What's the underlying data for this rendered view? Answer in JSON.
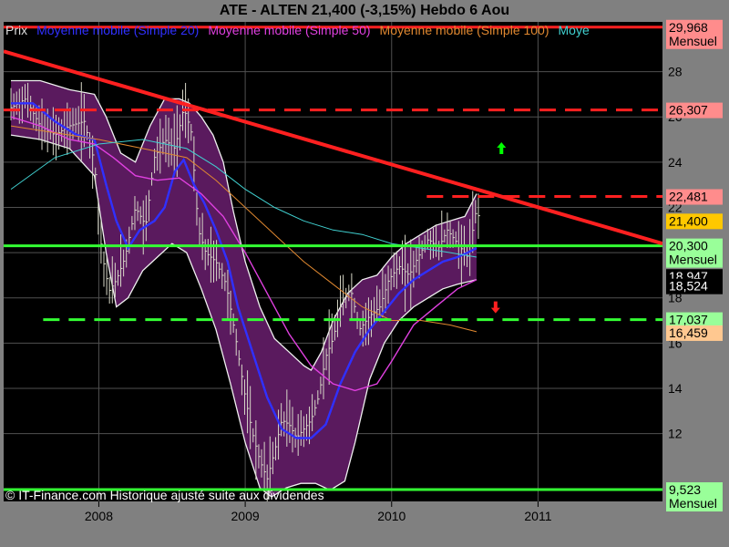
{
  "chart_data": {
    "type": "line",
    "title": "ATE - ALTEN    21,400 (-3,15%)    Hebdo  6 Aou",
    "footer": "© IT-Finance.com Historique ajusté suite aux dividendes",
    "legend": [
      {
        "label": "Prix",
        "color": "#dddddd"
      },
      {
        "label": "Moyenne mobile (Simple 20)",
        "color": "#3030ff"
      },
      {
        "label": "Moyenne mobile (Simple 50)",
        "color": "#e040e0"
      },
      {
        "label": "Moyenne mobile (Simple 100)",
        "color": "#e08830"
      },
      {
        "label": "Moye",
        "color": "#40d0d0"
      }
    ],
    "legend_placement": "top-left",
    "x_ticks": [
      2008,
      2009,
      2010,
      2011
    ],
    "xlim": [
      2007.35,
      2011.85
    ],
    "y_ticks": [
      12,
      14,
      16,
      18,
      20,
      22,
      24,
      26,
      28
    ],
    "ylim": [
      9.0,
      30.2
    ],
    "grid": true,
    "price": [
      [
        2007.4,
        26.4
      ],
      [
        2007.5,
        26.8
      ],
      [
        2007.6,
        25.6
      ],
      [
        2007.7,
        25.2
      ],
      [
        2007.8,
        25.6
      ],
      [
        2007.9,
        25.8
      ],
      [
        2007.97,
        24.0
      ],
      [
        2008.02,
        20.0
      ],
      [
        2008.07,
        18.3
      ],
      [
        2008.12,
        18.8
      ],
      [
        2008.18,
        19.8
      ],
      [
        2008.25,
        22.0
      ],
      [
        2008.32,
        21.2
      ],
      [
        2008.38,
        24.2
      ],
      [
        2008.45,
        25.0
      ],
      [
        2008.52,
        24.6
      ],
      [
        2008.58,
        26.4
      ],
      [
        2008.63,
        25.4
      ],
      [
        2008.68,
        21.0
      ],
      [
        2008.73,
        20.0
      ],
      [
        2008.8,
        19.6
      ],
      [
        2008.87,
        18.6
      ],
      [
        2008.93,
        16.4
      ],
      [
        2009.0,
        13.6
      ],
      [
        2009.05,
        12.0
      ],
      [
        2009.1,
        10.8
      ],
      [
        2009.15,
        10.0
      ],
      [
        2009.2,
        11.2
      ],
      [
        2009.25,
        12.6
      ],
      [
        2009.3,
        12.4
      ],
      [
        2009.35,
        11.8
      ],
      [
        2009.4,
        12.2
      ],
      [
        2009.45,
        12.6
      ],
      [
        2009.5,
        13.6
      ],
      [
        2009.55,
        15.4
      ],
      [
        2009.6,
        16.2
      ],
      [
        2009.65,
        17.6
      ],
      [
        2009.72,
        18.4
      ],
      [
        2009.78,
        16.6
      ],
      [
        2009.85,
        17.2
      ],
      [
        2009.92,
        17.6
      ],
      [
        2009.98,
        18.8
      ],
      [
        2010.05,
        19.4
      ],
      [
        2010.12,
        19.0
      ],
      [
        2010.18,
        19.8
      ],
      [
        2010.25,
        20.6
      ],
      [
        2010.32,
        20.2
      ],
      [
        2010.38,
        21.0
      ],
      [
        2010.45,
        20.4
      ],
      [
        2010.52,
        19.8
      ],
      [
        2010.56,
        21.2
      ],
      [
        2010.58,
        22.0
      ],
      [
        2010.6,
        21.4
      ]
    ],
    "series": [
      {
        "name": "Moyenne mobile (Simple 20)",
        "color": "#3030ff",
        "points": [
          [
            2007.4,
            26.6
          ],
          [
            2007.55,
            26.6
          ],
          [
            2007.7,
            25.8
          ],
          [
            2007.85,
            25.2
          ],
          [
            2007.97,
            25.0
          ],
          [
            2008.05,
            23.0
          ],
          [
            2008.12,
            21.4
          ],
          [
            2008.2,
            20.2
          ],
          [
            2008.28,
            21.0
          ],
          [
            2008.38,
            21.4
          ],
          [
            2008.45,
            22.0
          ],
          [
            2008.52,
            23.6
          ],
          [
            2008.58,
            24.1
          ],
          [
            2008.65,
            23.0
          ],
          [
            2008.72,
            22.2
          ],
          [
            2008.8,
            21.0
          ],
          [
            2008.88,
            19.6
          ],
          [
            2008.95,
            17.6
          ],
          [
            2009.05,
            15.6
          ],
          [
            2009.15,
            13.6
          ],
          [
            2009.25,
            12.2
          ],
          [
            2009.35,
            11.8
          ],
          [
            2009.45,
            11.8
          ],
          [
            2009.55,
            12.4
          ],
          [
            2009.65,
            14.2
          ],
          [
            2009.75,
            15.6
          ],
          [
            2009.85,
            16.6
          ],
          [
            2009.95,
            17.4
          ],
          [
            2010.05,
            18.2
          ],
          [
            2010.15,
            18.8
          ],
          [
            2010.25,
            19.2
          ],
          [
            2010.35,
            19.6
          ],
          [
            2010.45,
            19.8
          ],
          [
            2010.52,
            20.0
          ],
          [
            2010.58,
            20.2
          ]
        ]
      },
      {
        "name": "Moyenne mobile (Simple 50)",
        "color": "#e040e0",
        "points": [
          [
            2007.4,
            26.0
          ],
          [
            2007.6,
            25.6
          ],
          [
            2007.8,
            25.0
          ],
          [
            2007.97,
            24.8
          ],
          [
            2008.1,
            24.2
          ],
          [
            2008.25,
            23.4
          ],
          [
            2008.4,
            23.2
          ],
          [
            2008.55,
            23.3
          ],
          [
            2008.7,
            22.6
          ],
          [
            2008.85,
            21.6
          ],
          [
            2009.0,
            20.0
          ],
          [
            2009.15,
            18.2
          ],
          [
            2009.3,
            16.4
          ],
          [
            2009.45,
            15.0
          ],
          [
            2009.6,
            14.2
          ],
          [
            2009.75,
            13.9
          ],
          [
            2009.9,
            14.2
          ],
          [
            2010.0,
            15.2
          ],
          [
            2010.15,
            16.8
          ],
          [
            2010.3,
            17.6
          ],
          [
            2010.45,
            18.4
          ],
          [
            2010.58,
            18.8
          ]
        ]
      },
      {
        "name": "Moyenne mobile (Simple 100)",
        "color": "#e08830",
        "points": [
          [
            2007.4,
            25.6
          ],
          [
            2007.7,
            25.3
          ],
          [
            2008.0,
            25.0
          ],
          [
            2008.3,
            24.6
          ],
          [
            2008.6,
            24.2
          ],
          [
            2008.8,
            23.2
          ],
          [
            2009.0,
            22.0
          ],
          [
            2009.2,
            20.8
          ],
          [
            2009.4,
            19.6
          ],
          [
            2009.6,
            18.6
          ],
          [
            2009.8,
            17.6
          ],
          [
            2010.0,
            17.0
          ],
          [
            2010.2,
            17.0
          ],
          [
            2010.4,
            16.8
          ],
          [
            2010.58,
            16.5
          ]
        ]
      },
      {
        "name": "Moye",
        "color": "#40d0d0",
        "points": [
          [
            2007.4,
            22.8
          ],
          [
            2007.7,
            24.2
          ],
          [
            2008.0,
            24.8
          ],
          [
            2008.3,
            25.0
          ],
          [
            2008.6,
            24.6
          ],
          [
            2008.8,
            23.8
          ],
          [
            2009.0,
            22.8
          ],
          [
            2009.2,
            22.0
          ],
          [
            2009.4,
            21.4
          ],
          [
            2009.6,
            21.0
          ],
          [
            2009.8,
            20.8
          ],
          [
            2010.0,
            20.4
          ],
          [
            2010.2,
            20.2
          ],
          [
            2010.4,
            20.0
          ],
          [
            2010.58,
            19.8
          ]
        ]
      }
    ],
    "bollinger": {
      "upper": [
        [
          2007.4,
          27.6
        ],
        [
          2007.6,
          27.6
        ],
        [
          2007.8,
          27.2
        ],
        [
          2007.97,
          27.0
        ],
        [
          2008.05,
          26.0
        ],
        [
          2008.15,
          24.4
        ],
        [
          2008.25,
          24.0
        ],
        [
          2008.35,
          25.6
        ],
        [
          2008.45,
          26.8
        ],
        [
          2008.55,
          26.8
        ],
        [
          2008.62,
          26.6
        ],
        [
          2008.7,
          26.0
        ],
        [
          2008.78,
          25.2
        ],
        [
          2008.85,
          24.0
        ],
        [
          2008.92,
          21.8
        ],
        [
          2009.0,
          19.6
        ],
        [
          2009.1,
          17.6
        ],
        [
          2009.2,
          16.2
        ],
        [
          2009.3,
          15.6
        ],
        [
          2009.4,
          15.0
        ],
        [
          2009.45,
          14.8
        ],
        [
          2009.52,
          15.6
        ],
        [
          2009.6,
          17.0
        ],
        [
          2009.7,
          18.2
        ],
        [
          2009.8,
          18.8
        ],
        [
          2009.9,
          19.0
        ],
        [
          2010.0,
          19.8
        ],
        [
          2010.1,
          20.4
        ],
        [
          2010.2,
          20.8
        ],
        [
          2010.3,
          21.2
        ],
        [
          2010.4,
          21.4
        ],
        [
          2010.5,
          21.6
        ],
        [
          2010.58,
          22.6
        ]
      ],
      "lower": [
        [
          2007.4,
          25.2
        ],
        [
          2007.6,
          25.0
        ],
        [
          2007.8,
          24.6
        ],
        [
          2007.97,
          23.4
        ],
        [
          2008.05,
          20.0
        ],
        [
          2008.12,
          17.6
        ],
        [
          2008.2,
          18.0
        ],
        [
          2008.3,
          19.2
        ],
        [
          2008.4,
          19.8
        ],
        [
          2008.5,
          20.4
        ],
        [
          2008.6,
          20.0
        ],
        [
          2008.7,
          18.4
        ],
        [
          2008.8,
          16.6
        ],
        [
          2008.9,
          14.2
        ],
        [
          2009.0,
          11.6
        ],
        [
          2009.1,
          9.6
        ],
        [
          2009.18,
          9.2
        ],
        [
          2009.28,
          9.6
        ],
        [
          2009.38,
          9.8
        ],
        [
          2009.48,
          9.8
        ],
        [
          2009.58,
          9.5
        ],
        [
          2009.68,
          9.9
        ],
        [
          2009.75,
          11.6
        ],
        [
          2009.85,
          14.4
        ],
        [
          2009.95,
          16.0
        ],
        [
          2010.05,
          17.0
        ],
        [
          2010.15,
          17.6
        ],
        [
          2010.25,
          18.0
        ],
        [
          2010.35,
          18.4
        ],
        [
          2010.45,
          18.6
        ],
        [
          2010.58,
          18.8
        ]
      ]
    },
    "hlines": [
      {
        "y": 29.968,
        "color": "#ff2020",
        "style": "solid",
        "x_from": 2007.35,
        "x_to": 2011.85
      },
      {
        "y": 26.307,
        "color": "#ff2020",
        "style": "dashed",
        "x_from": 2007.35,
        "x_to": 2011.85
      },
      {
        "y": 22.481,
        "color": "#ff2020",
        "style": "dashed",
        "x_from": 2010.24,
        "x_to": 2011.85
      },
      {
        "y": 20.3,
        "color": "#33ff33",
        "style": "solid",
        "x_from": 2007.35,
        "x_to": 2011.85
      },
      {
        "y": 17.037,
        "color": "#33ff33",
        "style": "dashed",
        "x_from": 2007.62,
        "x_to": 2011.85
      },
      {
        "y": 9.523,
        "color": "#33ff33",
        "style": "solid",
        "x_from": 2007.35,
        "x_to": 2011.85
      }
    ],
    "trendline": {
      "color": "#ff2020",
      "from": [
        2007.35,
        28.9
      ],
      "to": [
        2011.85,
        20.4
      ]
    },
    "arrows": [
      {
        "x": 2010.75,
        "y": 24.6,
        "direction": "up",
        "color": "#00ff00"
      },
      {
        "x": 2010.71,
        "y": 17.6,
        "direction": "down",
        "color": "#ff2020"
      }
    ],
    "price_labels": [
      {
        "value": "29,968",
        "y": 29.968,
        "bg": "#ff8c8c",
        "sub": "Mensuel"
      },
      {
        "value": "26,307",
        "y": 26.307,
        "bg": "#ff8c8c"
      },
      {
        "value": "22,481",
        "y": 22.481,
        "bg": "#ff8c8c"
      },
      {
        "value": "21,400",
        "y": 21.4,
        "bg": "#ffc800"
      },
      {
        "value": "20,300",
        "y": 20.3,
        "bg": "#99ff99",
        "sub": "Mensuel"
      },
      {
        "value": "18,947",
        "y": 18.947,
        "bg": "#000000",
        "fg": "#ffffff"
      },
      {
        "value": "18,524",
        "y": 18.524,
        "bg": "#000000",
        "fg": "#ffffff"
      },
      {
        "value": "17,037",
        "y": 17.037,
        "bg": "#99ff99"
      },
      {
        "value": "16,459",
        "y": 16.459,
        "bg": "#ffc890"
      },
      {
        "value": "9,523",
        "y": 9.523,
        "bg": "#99ff99",
        "sub": "Mensuel"
      }
    ],
    "colors": {
      "background": "#000000",
      "frame": "#808080",
      "grid": "#505050",
      "band_fill": "#5a1a5e",
      "band_edge": "#f0f0f0",
      "price_bars": "#d8d8c8"
    }
  }
}
